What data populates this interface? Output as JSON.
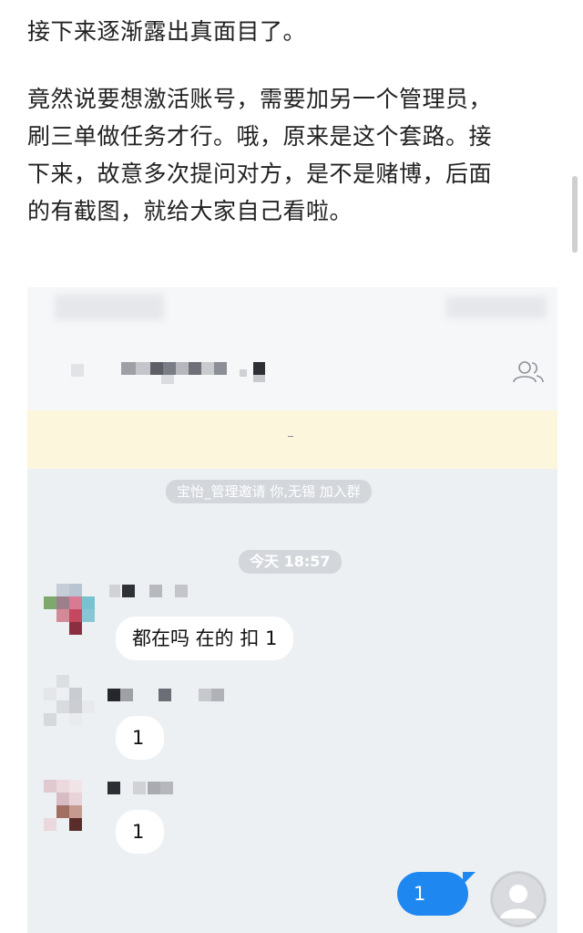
{
  "article": {
    "para1": "接下来逐渐露出真面目了。",
    "para2_line1": "竟然说要想激活账号，需要加另一个管理员，",
    "para2_line2": "刷三单做任务才行。哦，原来是这个套路。接",
    "para2_line3": "下来，故意多次提问对方，是不是赌博，后面",
    "para2_line4": "的有截图，就给大家自己看啦。"
  },
  "chat": {
    "group_icon": "group-members-icon",
    "banner_text": "-",
    "system_message": "宝怡_管理邀请 你,无锡 加入群",
    "time_label": "今天 18:57",
    "messages": [
      {
        "from": "member",
        "text": "都在吗 在的 扣 1"
      },
      {
        "from": "member",
        "text": "1"
      },
      {
        "from": "member",
        "text": "1"
      },
      {
        "from": "me",
        "text": "1"
      }
    ]
  },
  "colors": {
    "chat_background": "#edf0f3",
    "banner": "#fcf6dd",
    "my_bubble": "#1e88f0",
    "pill": "#d3d7dc"
  }
}
